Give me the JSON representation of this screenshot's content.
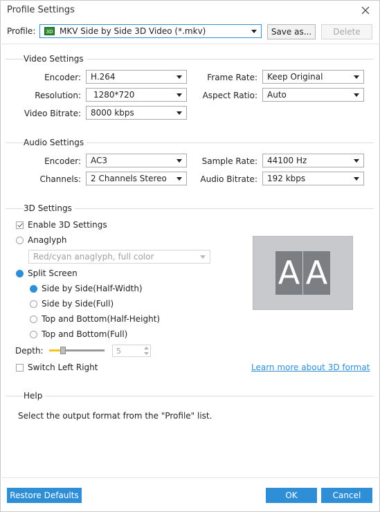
{
  "window": {
    "title": "Profile Settings"
  },
  "profile": {
    "label": "Profile:",
    "badge": "3D",
    "value": "MKV Side by Side 3D Video (*.mkv)",
    "save_as": "Save as...",
    "delete": "Delete"
  },
  "video": {
    "heading": "Video Settings",
    "encoder_label": "Encoder:",
    "encoder": "H.264",
    "resolution_label": "Resolution:",
    "resolution": "1280*720",
    "bitrate_label": "Video Bitrate:",
    "bitrate": "8000 kbps",
    "framerate_label": "Frame Rate:",
    "framerate": "Keep Original",
    "aspect_label": "Aspect Ratio:",
    "aspect": "Auto"
  },
  "audio": {
    "heading": "Audio Settings",
    "encoder_label": "Encoder:",
    "encoder": "AC3",
    "channels_label": "Channels:",
    "channels": "2 Channels Stereo",
    "samplerate_label": "Sample Rate:",
    "samplerate": "44100 Hz",
    "bitrate_label": "Audio Bitrate:",
    "bitrate": "192 kbps"
  },
  "settings3d": {
    "heading": "3D Settings",
    "enable": "Enable 3D Settings",
    "anaglyph": "Anaglyph",
    "anaglyph_mode": "Red/cyan anaglyph, full color",
    "split_screen": "Split Screen",
    "sbs_half": "Side by Side(Half-Width)",
    "sbs_full": "Side by Side(Full)",
    "tb_half": "Top and Bottom(Half-Height)",
    "tb_full": "Top and Bottom(Full)",
    "depth_label": "Depth:",
    "depth_value": "5",
    "depth_level": 0.25,
    "switch_lr": "Switch Left Right",
    "learn_more": "Learn more about 3D format",
    "preview_left": "A",
    "preview_right": "A"
  },
  "help": {
    "heading": "Help",
    "text": "Select the output format from the \"Profile\" list."
  },
  "footer": {
    "restore": "Restore Defaults",
    "ok": "OK",
    "cancel": "Cancel"
  },
  "colors": {
    "accent": "#2f8fd6",
    "slider_fill": "#f5c518"
  }
}
